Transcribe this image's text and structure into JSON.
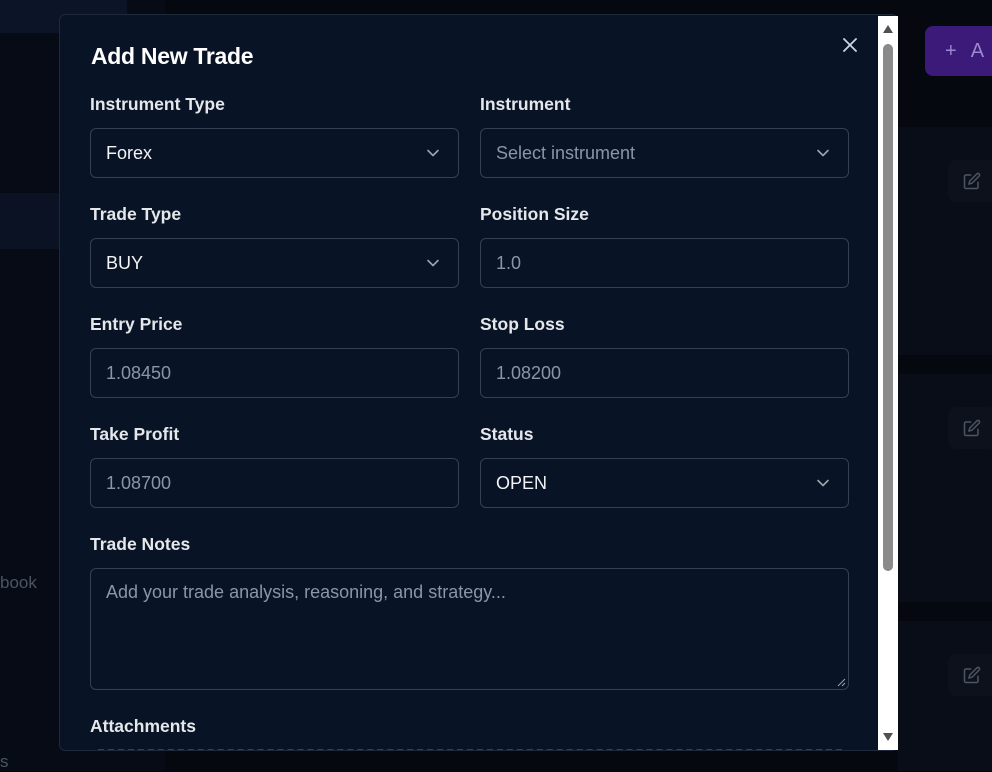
{
  "background": {
    "sidebar_partial_label": "book",
    "sidebar_bottom_partial_label": "s",
    "add_button_icon": "plus-icon",
    "add_button_partial_label": "A",
    "edit_icon": "edit-icon"
  },
  "modal": {
    "title": "Add New Trade",
    "close_icon": "close-icon",
    "fields": {
      "instrument_type": {
        "label": "Instrument Type",
        "value": "Forex"
      },
      "instrument": {
        "label": "Instrument",
        "placeholder": "Select instrument"
      },
      "trade_type": {
        "label": "Trade Type",
        "value": "BUY"
      },
      "position_size": {
        "label": "Position Size",
        "placeholder": "1.0"
      },
      "entry_price": {
        "label": "Entry Price",
        "placeholder": "1.08450"
      },
      "stop_loss": {
        "label": "Stop Loss",
        "placeholder": "1.08200"
      },
      "take_profit": {
        "label": "Take Profit",
        "placeholder": "1.08700"
      },
      "status": {
        "label": "Status",
        "value": "OPEN"
      },
      "trade_notes": {
        "label": "Trade Notes",
        "placeholder": "Add your trade analysis, reasoning, and strategy..."
      },
      "attachments": {
        "label": "Attachments"
      }
    }
  },
  "colors": {
    "modal_bg": "#081425",
    "border": "#334155",
    "accent": "#3b1a7a"
  }
}
